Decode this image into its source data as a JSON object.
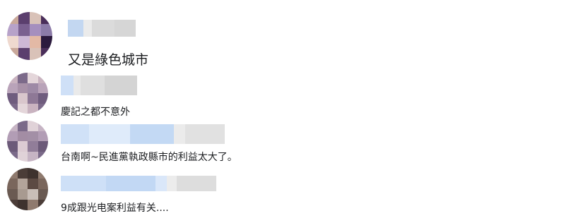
{
  "comments": [
    {
      "text": "又是綠色城市",
      "avatar_colors": [
        "#c9a89a",
        "#8c7ba8",
        "#e3b9a5",
        "#5b3f6e",
        "#b7a2c9",
        "#2b1a3d",
        "#d9c2b8",
        "#7a6090",
        "#efd9cf",
        "#4a2e5a",
        "#a58fbe",
        "#cdb8d6"
      ],
      "name_blur_colors": [
        "#b9d0ef",
        "#e8e8e8",
        "#d5d5d5",
        "#cfcfcf"
      ]
    },
    {
      "text": "慶記之都不意外",
      "avatar_colors": [
        "#c9b3c0",
        "#9e8aa6",
        "#d9c6cc",
        "#7c6a8a",
        "#b9a3b9",
        "#8e7896",
        "#e4d6da",
        "#a891a8",
        "#6f5c7e"
      ],
      "name_blur_colors": [
        "#c7dbf6",
        "#e6e6e6",
        "#d9d9d9",
        "#cccccc"
      ]
    },
    {
      "text": "台南啊~民進黨執政縣市的利益太大了。",
      "avatar_colors": [
        "#c6b4c4",
        "#a38fa6",
        "#dccbd3",
        "#7b6a89",
        "#b29db5",
        "#917d99",
        "#e0d2d8",
        "#a38da4",
        "#6c5a79"
      ],
      "name_blur_colors": [
        "#c8dcf6",
        "#d9e7f9",
        "#b9d2f2",
        "#e7e7e7",
        "#dcdcdc"
      ]
    },
    {
      "text": "9成跟光电案利益有关....",
      "avatar_colors": [
        "#8f7a6e",
        "#5c4a43",
        "#a89a90",
        "#4b3d38",
        "#7a665c",
        "#c9beb7",
        "#3e322e",
        "#b3a49a",
        "#6a5a52"
      ],
      "name_blur_colors": [
        "#c6dbf6",
        "#b7d1f2",
        "#d3e3f8",
        "#e9e9e9",
        "#d7d7d7"
      ]
    }
  ]
}
